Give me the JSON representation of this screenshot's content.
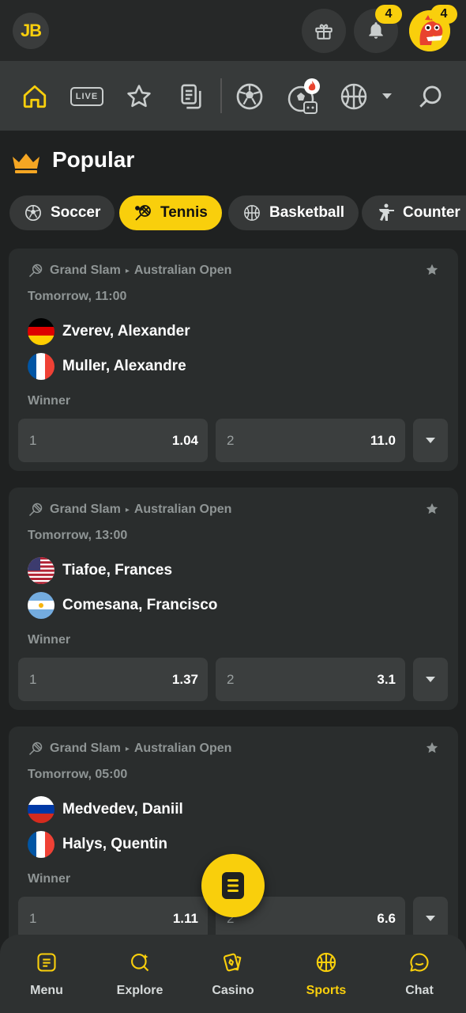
{
  "header": {
    "logo_text": "JB",
    "notifications_badge": "4",
    "profile_badge": "4"
  },
  "nav": {
    "live_label": "LIVE",
    "icons": [
      "home-icon",
      "live-icon",
      "star-icon",
      "betslip-icon",
      "soccer-icon",
      "hot-soccer-icon",
      "basketball-icon",
      "chevron-down-icon",
      "search-icon"
    ]
  },
  "section": {
    "title": "Popular"
  },
  "chips": [
    {
      "label": "Soccer",
      "icon": "soccer-icon",
      "active": false
    },
    {
      "label": "Tennis",
      "icon": "tennis-icon",
      "active": true
    },
    {
      "label": "Basketball",
      "icon": "basketball-icon",
      "active": false
    },
    {
      "label": "Counter",
      "icon": "counter-strike-icon",
      "active": false
    }
  ],
  "matches": [
    {
      "category": "Grand Slam",
      "tournament": "Australian Open",
      "time": "Tomorrow, 11:00",
      "team1": {
        "name": "Zverev, Alexander",
        "flag": "germany"
      },
      "team2": {
        "name": "Muller, Alexandre",
        "flag": "france"
      },
      "market": "Winner",
      "odds": [
        {
          "label": "1",
          "value": "1.04"
        },
        {
          "label": "2",
          "value": "11.0"
        }
      ]
    },
    {
      "category": "Grand Slam",
      "tournament": "Australian Open",
      "time": "Tomorrow, 13:00",
      "team1": {
        "name": "Tiafoe, Frances",
        "flag": "usa"
      },
      "team2": {
        "name": "Comesana, Francisco",
        "flag": "argentina"
      },
      "market": "Winner",
      "odds": [
        {
          "label": "1",
          "value": "1.37"
        },
        {
          "label": "2",
          "value": "3.1"
        }
      ]
    },
    {
      "category": "Grand Slam",
      "tournament": "Australian Open",
      "time": "Tomorrow, 05:00",
      "team1": {
        "name": "Medvedev, Daniil",
        "flag": "russia"
      },
      "team2": {
        "name": "Halys, Quentin",
        "flag": "france"
      },
      "market": "Winner",
      "odds": [
        {
          "label": "1",
          "value": "1.11"
        },
        {
          "label": "2",
          "value": "6.6"
        }
      ]
    }
  ],
  "bottom_nav": [
    {
      "label": "Menu",
      "icon": "menu-icon",
      "active": false
    },
    {
      "label": "Explore",
      "icon": "explore-icon",
      "active": false
    },
    {
      "label": "Casino",
      "icon": "casino-icon",
      "active": false
    },
    {
      "label": "Sports",
      "icon": "sports-icon",
      "active": true
    },
    {
      "label": "Chat",
      "icon": "chat-icon",
      "active": false
    }
  ],
  "colors": {
    "accent": "#f9cf0c",
    "background": "#1f2121",
    "card": "#2a2d2d",
    "odd_button": "#3b3e3e"
  }
}
